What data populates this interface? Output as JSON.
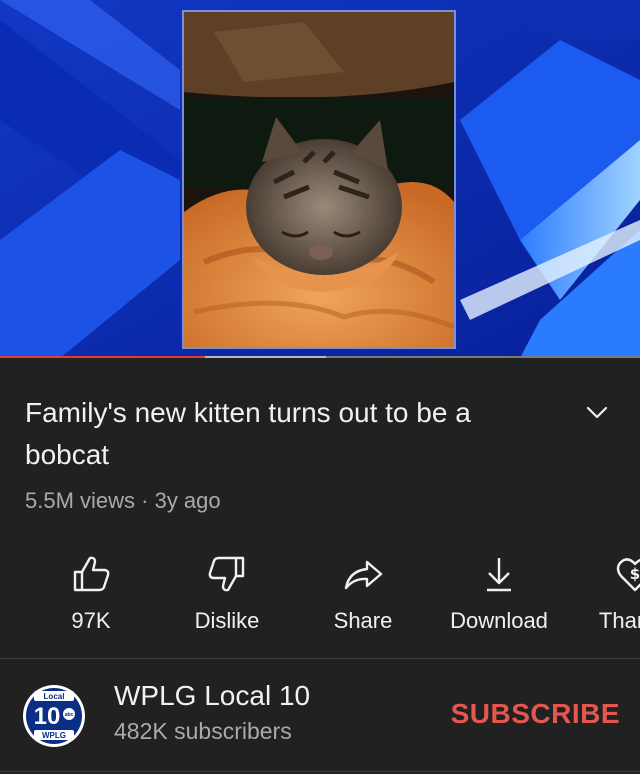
{
  "video": {
    "progress_fraction": 0.32,
    "buffered_fraction": 0.51,
    "thumbnail_subject": "sleeping-bobcat-kitten",
    "colors": {
      "background": "#0d2fa8",
      "progress": "#e53935"
    }
  },
  "title": "Family's new kitten turns out to be a bobcat",
  "meta": "5.5M views · 3y ago",
  "actions": [
    {
      "label": "97K",
      "icon": "thumbs-up-icon"
    },
    {
      "label": "Dislike",
      "icon": "thumbs-down-icon"
    },
    {
      "label": "Share",
      "icon": "share-icon"
    },
    {
      "label": "Download",
      "icon": "download-icon"
    },
    {
      "label": "Thanks",
      "icon": "thanks-heart-icon"
    }
  ],
  "channel": {
    "name": "WPLG Local 10",
    "subscribers": "482K subscribers",
    "logo_text": {
      "top": "Local",
      "number": "10",
      "network": "abc",
      "bottom": "WPLG"
    }
  },
  "subscribe_label": "SUBSCRIBE",
  "colors": {
    "background": "#212121",
    "subscribe": "#e4574f",
    "secondary_text": "#aaaaaa"
  }
}
